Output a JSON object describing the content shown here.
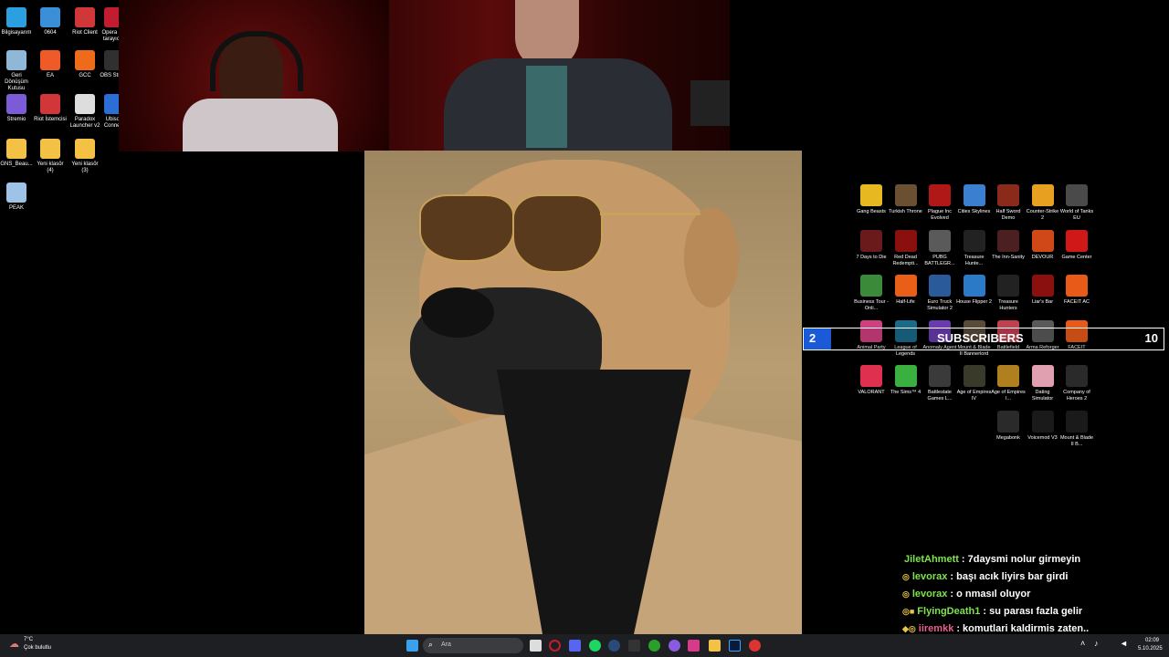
{
  "desktop": {
    "icons": [
      {
        "label": "Bilgisayarım",
        "color": "#2aa0e0"
      },
      {
        "label": "0604",
        "color": "#3b8fd6"
      },
      {
        "label": "Riot Client",
        "color": "#d13639"
      },
      {
        "label": "Opera GX tarayıcısı",
        "color": "#c21d2e"
      },
      {
        "label": "Geri Dönüşüm Kutusu",
        "color": "#8fb8d8"
      },
      {
        "label": "EA",
        "color": "#f05a28"
      },
      {
        "label": "GCC",
        "color": "#ef6b1c"
      },
      {
        "label": "OBS Studio",
        "color": "#303030"
      },
      {
        "label": "Stremio",
        "color": "#7b5bd6"
      },
      {
        "label": "Riot İstemcisi",
        "color": "#d13639"
      },
      {
        "label": "Paradox Launcher v2",
        "color": "#dddddd"
      },
      {
        "label": "Ubisoft Connect",
        "color": "#2b6fd6"
      },
      {
        "label": "GNS_Beau...",
        "color": "#f3c244"
      },
      {
        "label": "Yeni klasör (4)",
        "color": "#f3c244"
      },
      {
        "label": "Yeni klasör (3)",
        "color": "#f3c244"
      },
      {
        "label": "PEAK",
        "color": "#9ec3e6"
      }
    ]
  },
  "game_icons": [
    {
      "label": "Gang Beasts",
      "color": "#e8b820"
    },
    {
      "label": "Turkish Throne",
      "color": "#6a5030"
    },
    {
      "label": "Plague Inc Evolved",
      "color": "#b01818"
    },
    {
      "label": "Cities Skylines",
      "color": "#3a7fd0"
    },
    {
      "label": "Half Sword Demo",
      "color": "#8a2a1a"
    },
    {
      "label": "Counter-Strike 2",
      "color": "#e8a020"
    },
    {
      "label": "World of Tanks EU",
      "color": "#4a4a4a"
    },
    {
      "label": "7 Days to Die",
      "color": "#6a1a1a"
    },
    {
      "label": "Red Dead Redempti...",
      "color": "#8a1010"
    },
    {
      "label": "PUBG BATTLEGR...",
      "color": "#5a5a5a"
    },
    {
      "label": "Treasure Hunte...",
      "color": "#222222"
    },
    {
      "label": "The Inn-Sanity",
      "color": "#4a2020"
    },
    {
      "label": "DEVOUR",
      "color": "#d04818"
    },
    {
      "label": "Game Center",
      "color": "#d01818"
    },
    {
      "label": "Business Tour - Onli...",
      "color": "#3a8a3a"
    },
    {
      "label": "Half-Life",
      "color": "#e86018"
    },
    {
      "label": "Euro Truck Simulator 2",
      "color": "#2a5a9a"
    },
    {
      "label": "House Flipper 2",
      "color": "#2a7ac8"
    },
    {
      "label": "Treasure Hunters",
      "color": "#222222"
    },
    {
      "label": "Liar's Bar",
      "color": "#8a1010"
    },
    {
      "label": "FACEIT AC",
      "color": "#e85a18"
    },
    {
      "label": "Animal Party",
      "color": "#d04080"
    },
    {
      "label": "League of Legends",
      "color": "#1a6a8a"
    },
    {
      "label": "Anomaly Agent",
      "color": "#6a3ab0"
    },
    {
      "label": "Mount & Blade II Bannerlord",
      "color": "#5a4a3a"
    },
    {
      "label": "Battlefield",
      "color": "#c04050"
    },
    {
      "label": "Arma Reforger",
      "color": "#5a5a5a"
    },
    {
      "label": "FACEIT",
      "color": "#e85a18"
    },
    {
      "label": "VALORANT",
      "color": "#e03050"
    },
    {
      "label": "The Sims™ 4",
      "color": "#3ab040"
    },
    {
      "label": "Battlestate Games L...",
      "color": "#3a3a3a"
    },
    {
      "label": "Age of Empires IV",
      "color": "#3a3a2a"
    },
    {
      "label": "Age of Empires I...",
      "color": "#b08020"
    },
    {
      "label": "Dating Simulator",
      "color": "#e0a0b0"
    },
    {
      "label": "Company of Heroes 2",
      "color": "#2a2a2a"
    },
    {
      "label": "Megabonk",
      "color": "#2a2a2a"
    },
    {
      "label": "Voicemod V3",
      "color": "#1a1a1a"
    },
    {
      "label": "Mount & Blade II B...",
      "color": "#1a1a1a"
    }
  ],
  "subscribers": {
    "current": "2",
    "label": "SUBSCRIBERS",
    "goal": "10",
    "progress": 0.2
  },
  "chat": [
    {
      "user": "JiletAhmett",
      "message": ": 7daysmi nolur girmeyin",
      "color": "#7ee44b",
      "badges": ""
    },
    {
      "user": "levorax",
      "message": ": başı acık liyirs bar girdi",
      "color": "#7ee44b",
      "badges": "◎"
    },
    {
      "user": "levorax",
      "message": ": o nmasıl oluyor",
      "color": "#7ee44b",
      "badges": "◎"
    },
    {
      "user": "FlyingDeath1",
      "message": ": su parası fazla gelir",
      "color": "#7ee44b",
      "badges": "◎■"
    },
    {
      "user": "iiremkk",
      "message": ": komutlari kaldirmis zaten..",
      "color": "#e8608a",
      "badges": "◆◎"
    }
  ],
  "taskbar": {
    "weather_temp": "7°C",
    "weather_desc": "Çok bulutlu",
    "search_placeholder": "Ara",
    "time": "02:09",
    "date": "5.10.2025"
  }
}
